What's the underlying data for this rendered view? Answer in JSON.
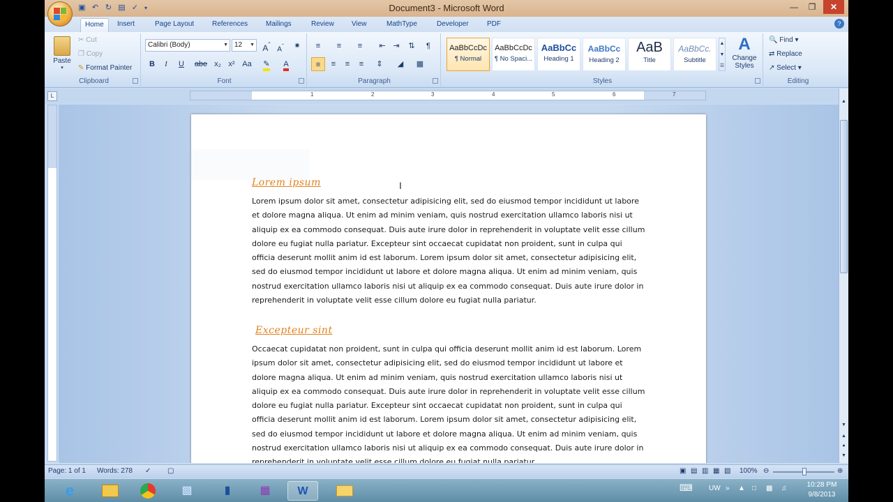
{
  "window": {
    "title": "Document3 - Microsoft Word"
  },
  "quick_access": [
    "save-icon",
    "undo-icon",
    "redo-icon",
    "print-preview-icon",
    "spelling-icon"
  ],
  "tabs": [
    {
      "label": "Home",
      "active": true
    },
    {
      "label": "Insert"
    },
    {
      "label": "Page Layout"
    },
    {
      "label": "References"
    },
    {
      "label": "Mailings"
    },
    {
      "label": "Review"
    },
    {
      "label": "View"
    },
    {
      "label": "MathType"
    },
    {
      "label": "Developer"
    },
    {
      "label": "PDF"
    }
  ],
  "clipboard": {
    "paste": "Paste",
    "cut": "Cut",
    "copy": "Copy",
    "format_painter": "Format Painter",
    "group_label": "Clipboard"
  },
  "font": {
    "family": "Calibri (Body)",
    "size": "12",
    "bold": "B",
    "italic": "I",
    "underline": "U",
    "strike": "abe",
    "subscript": "x₂",
    "superscript": "x²",
    "change_case": "Aa",
    "grow": "A",
    "shrink": "A",
    "group_label": "Font"
  },
  "paragraph": {
    "group_label": "Paragraph"
  },
  "styles": {
    "group_label": "Styles",
    "items": [
      {
        "sample": "AaBbCcDc",
        "name": "¶ Normal",
        "active": true
      },
      {
        "sample": "AaBbCcDc",
        "name": "¶ No Spaci..."
      },
      {
        "sample": "AaBbCc",
        "name": "Heading 1"
      },
      {
        "sample": "AaBbCc",
        "name": "Heading 2"
      },
      {
        "sample": "AaB",
        "name": "Title"
      },
      {
        "sample": "AaBbCc.",
        "name": "Subtitle"
      }
    ],
    "change_styles": "Change Styles"
  },
  "editing": {
    "find": "Find",
    "replace": "Replace",
    "select": "Select",
    "group_label": "Editing"
  },
  "ruler_numbers": [
    "1",
    "2",
    "3",
    "4",
    "5",
    "6",
    "7"
  ],
  "document": {
    "heading1": "Lorem ipsum",
    "para1": "Lorem ipsum dolor sit amet, consectetur adipisicing elit, sed do eiusmod tempor incididunt ut labore et dolore magna aliqua. Ut enim ad minim veniam, quis nostrud exercitation ullamco laboris nisi ut aliquip ex ea commodo consequat. Duis aute irure dolor in reprehenderit in voluptate velit esse cillum dolore eu fugiat nulla pariatur. Excepteur sint occaecat cupidatat non proident, sunt in culpa qui officia deserunt mollit anim id est laborum. Lorem ipsum dolor sit amet, consectetur adipisicing elit, sed do eiusmod tempor incididunt ut labore et dolore magna aliqua. Ut enim ad minim veniam, quis nostrud exercitation ullamco laboris nisi ut aliquip ex ea commodo consequat. Duis aute irure dolor in reprehenderit in voluptate velit esse cillum dolore eu fugiat nulla pariatur.",
    "heading2": "Excepteur sint",
    "para2": "Occaecat cupidatat non proident, sunt in culpa qui officia deserunt mollit anim id est laborum. Lorem ipsum dolor sit amet, consectetur adipisicing elit, sed do eiusmod tempor incididunt ut labore et dolore magna aliqua. Ut enim ad minim veniam, quis nostrud exercitation ullamco laboris nisi ut aliquip ex ea commodo consequat. Duis aute irure dolor in reprehenderit in voluptate velit esse cillum dolore eu fugiat nulla pariatur. Excepteur sint occaecat cupidatat non proident, sunt in culpa qui officia deserunt mollit anim id est laborum. Lorem ipsum dolor sit amet, consectetur adipisicing elit, sed do eiusmod tempor incididunt ut labore et dolore magna aliqua. Ut enim ad minim veniam, quis nostrud exercitation ullamco laboris nisi ut aliquip ex ea commodo consequat. Duis aute irure dolor in reprehenderit in voluptate velit esse cillum dolore eu fugiat nulla pariatur."
  },
  "status": {
    "page": "Page: 1 of 1",
    "words": "Words: 278",
    "zoom": "100%"
  },
  "taskbar": {
    "apps": [
      "internet-explorer-icon",
      "file-explorer-icon",
      "chrome-icon",
      "app-icon",
      "app-icon",
      "onenote-icon",
      "word-icon",
      "folder-icon"
    ],
    "lang": "UW",
    "time": "10:28 PM",
    "date": "9/8/2013"
  },
  "colors": {
    "heading": "#e2801b",
    "accent": "#15428b"
  }
}
